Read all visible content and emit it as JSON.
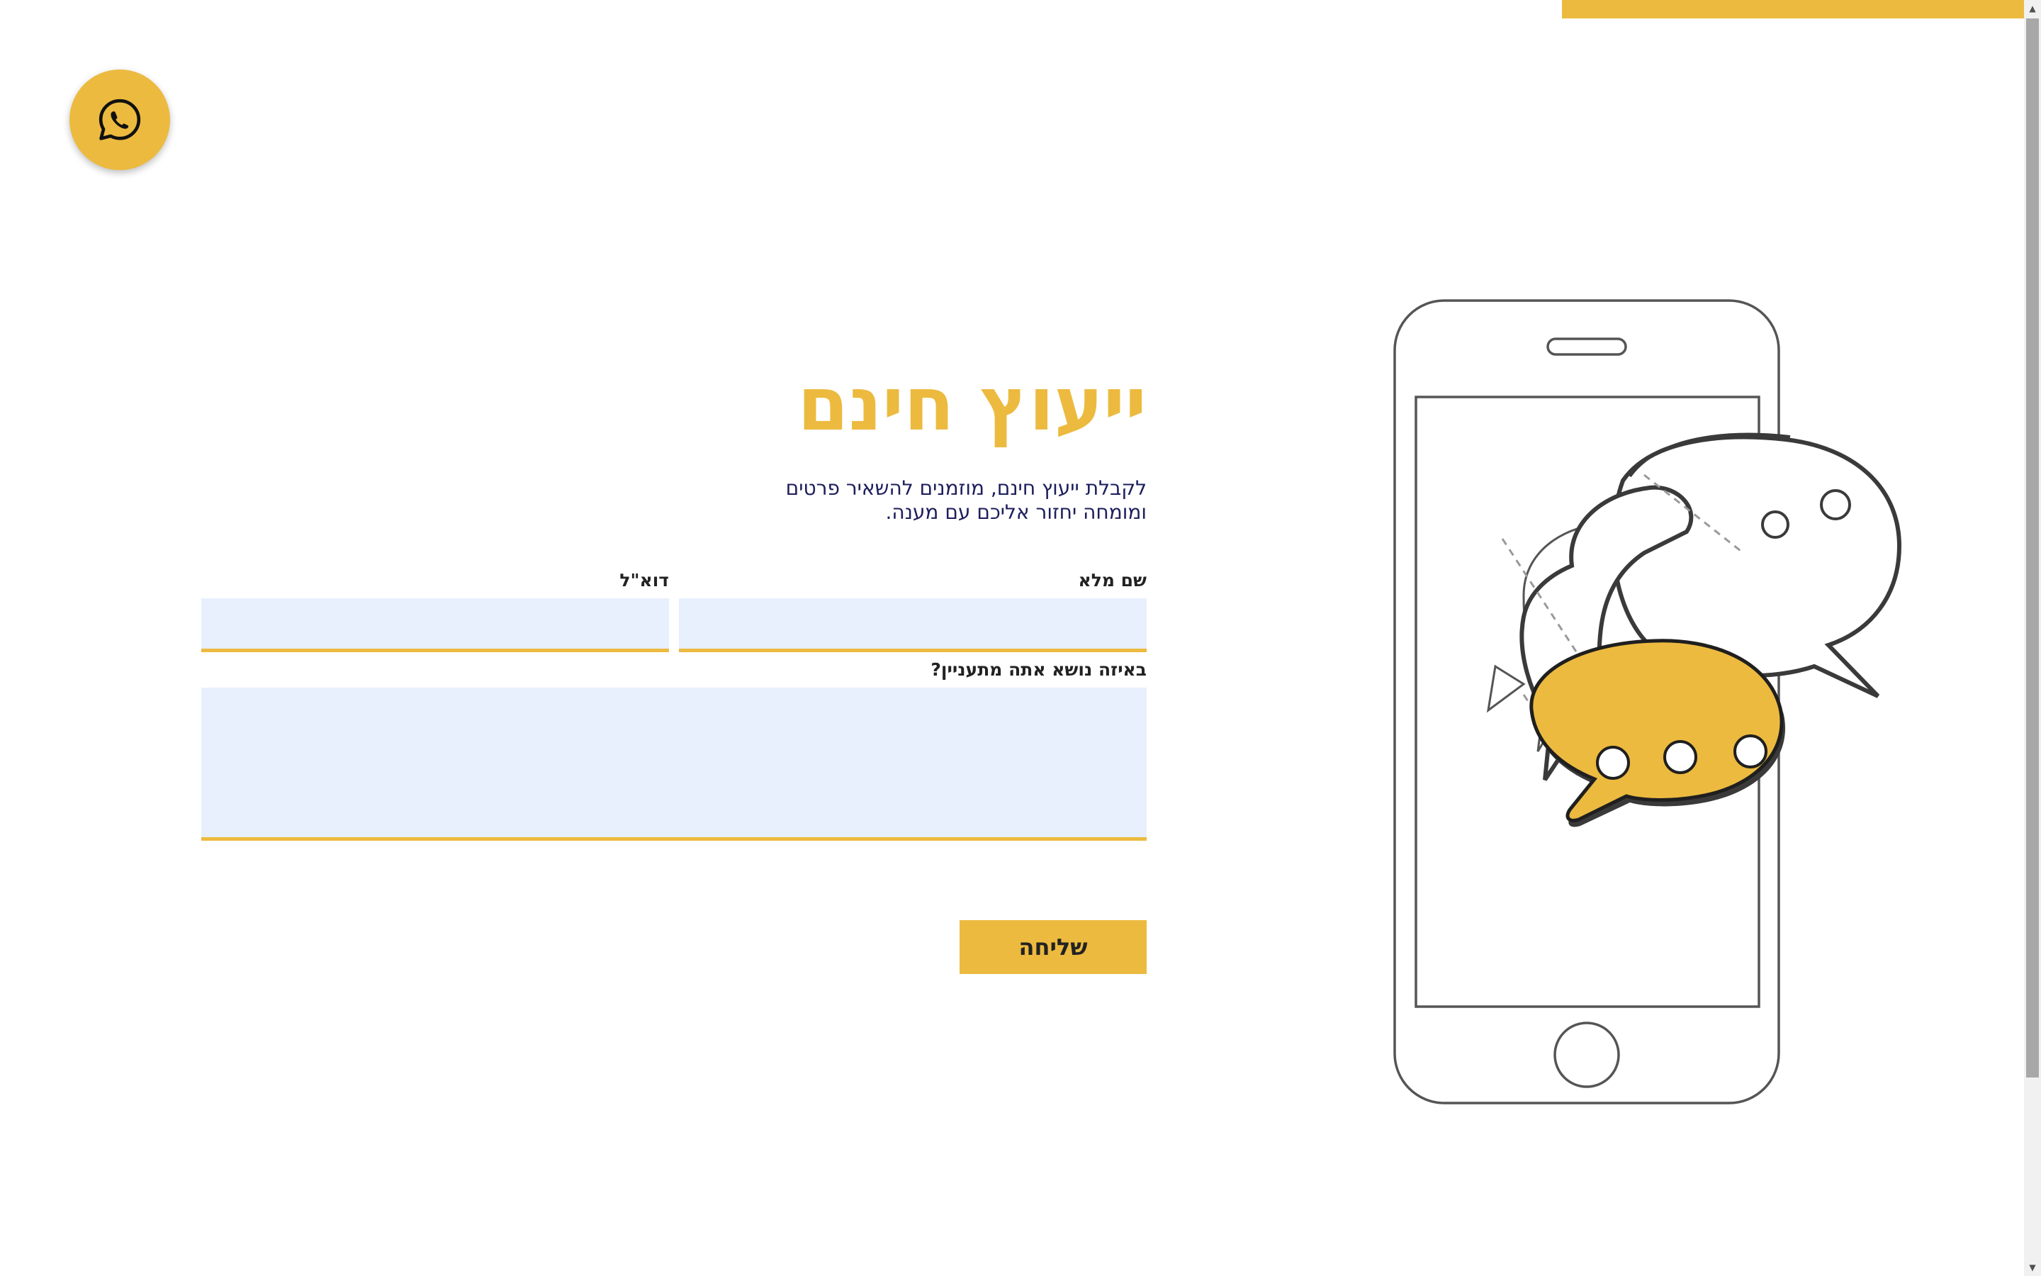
{
  "colors": {
    "accent": "#ecba3f",
    "text_dark": "#222222",
    "subtitle": "#1c1e5c",
    "field_bg": "#e8effd",
    "outline": "#555555"
  },
  "whatsapp": {
    "icon": "whatsapp-icon"
  },
  "hero": {
    "title": "ייעוץ חינם",
    "subtitle_line1": "לקבלת ייעוץ חינם, מוזמנים להשאיר פרטים",
    "subtitle_line2": "ומומחה יחזור אליכם עם מענה."
  },
  "form": {
    "full_name_label": "שם מלא",
    "full_name_value": "",
    "email_label": "דוא\"ל",
    "email_value": "",
    "topic_label": "באיזה נושא אתה מתעניין?",
    "topic_value": "",
    "submit_label": "שליחה"
  },
  "illustration": {
    "icon": "phone-chat-illustration"
  }
}
